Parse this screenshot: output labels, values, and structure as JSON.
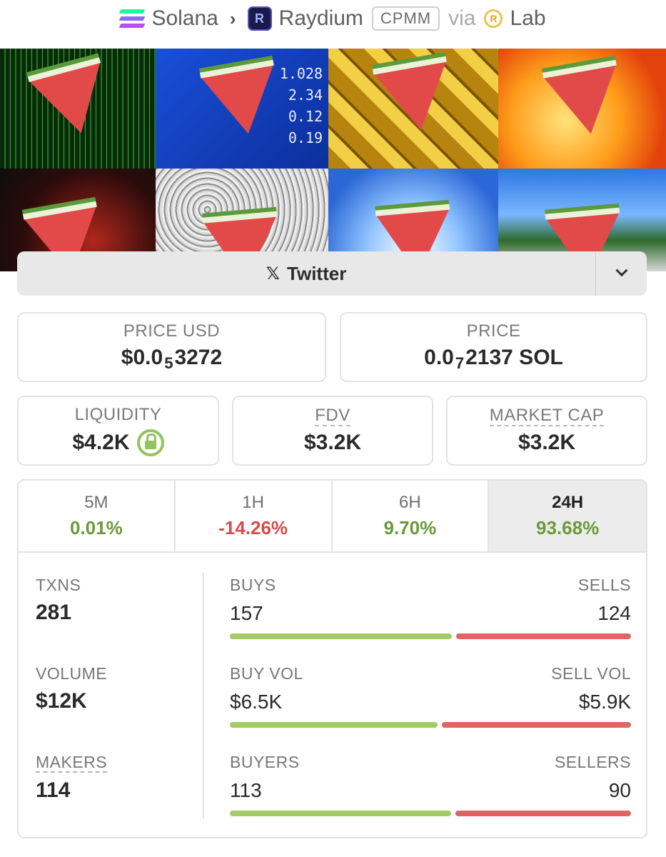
{
  "breadcrumb": {
    "chain": "Solana",
    "dex": "Raydium",
    "pool_type": "CPMM",
    "via": "via",
    "source": "Lab"
  },
  "social": {
    "twitter_label": "Twitter"
  },
  "price_usd": {
    "label": "PRICE USD",
    "prefix": "$0.0",
    "zeros": "5",
    "digits": "3272"
  },
  "price_native": {
    "label": "PRICE",
    "prefix": "0.0",
    "zeros": "7",
    "digits": "2137 SOL"
  },
  "liquidity": {
    "label": "LIQUIDITY",
    "value": "$4.2K",
    "locked": true
  },
  "fdv": {
    "label": "FDV",
    "value": "$3.2K"
  },
  "market_cap": {
    "label": "MARKET CAP",
    "value": "$3.2K"
  },
  "timeframes": [
    {
      "label": "5M",
      "change": "0.01%"
    },
    {
      "label": "1H",
      "change": "-14.26%"
    },
    {
      "label": "6H",
      "change": "9.70%"
    },
    {
      "label": "24H",
      "change": "93.68%"
    }
  ],
  "selected_timeframe": "24H",
  "txns": {
    "label": "TXNS",
    "value": "281",
    "buys_label": "BUYS",
    "buys": "157",
    "sells_label": "SELLS",
    "sells": "124",
    "buy_share": 0.559
  },
  "volume": {
    "label": "VOLUME",
    "value": "$12K",
    "buys_label": "BUY VOL",
    "buys": "$6.5K",
    "sells_label": "SELL VOL",
    "sells": "$5.9K",
    "buy_share": 0.524
  },
  "makers": {
    "label": "MAKERS",
    "value": "114",
    "buys_label": "BUYERS",
    "buys": "113",
    "sells_label": "SELLERS",
    "sells": "90",
    "buy_share": 0.557
  },
  "colors": {
    "positive": "#6a9a3a",
    "negative": "#d94a4a",
    "buy_bar": "#a3cc66",
    "sell_bar": "#e06464"
  }
}
